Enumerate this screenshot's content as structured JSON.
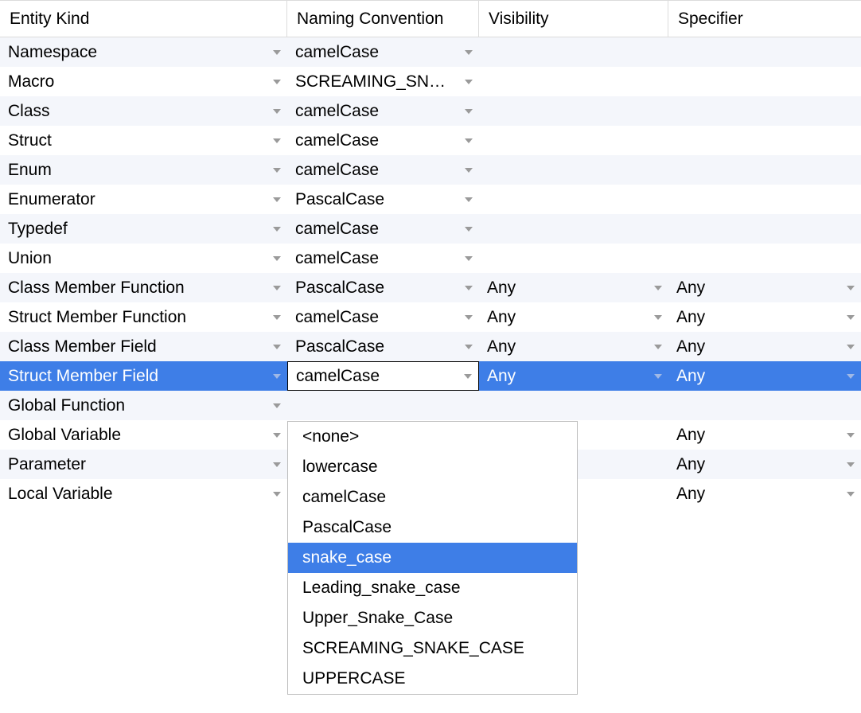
{
  "columns": [
    "Entity Kind",
    "Naming Convention",
    "Visibility",
    "Specifier"
  ],
  "rows": [
    {
      "kind": "Namespace",
      "naming": "camelCase",
      "visibility": null,
      "specifier": null
    },
    {
      "kind": "Macro",
      "naming": "SCREAMING_SN…",
      "visibility": null,
      "specifier": null
    },
    {
      "kind": "Class",
      "naming": "camelCase",
      "visibility": null,
      "specifier": null
    },
    {
      "kind": "Struct",
      "naming": "camelCase",
      "visibility": null,
      "specifier": null
    },
    {
      "kind": "Enum",
      "naming": "camelCase",
      "visibility": null,
      "specifier": null
    },
    {
      "kind": "Enumerator",
      "naming": "PascalCase",
      "visibility": null,
      "specifier": null
    },
    {
      "kind": "Typedef",
      "naming": "camelCase",
      "visibility": null,
      "specifier": null
    },
    {
      "kind": "Union",
      "naming": "camelCase",
      "visibility": null,
      "specifier": null
    },
    {
      "kind": "Class Member Function",
      "naming": "PascalCase",
      "visibility": "Any",
      "specifier": "Any"
    },
    {
      "kind": "Struct Member Function",
      "naming": "camelCase",
      "visibility": "Any",
      "specifier": "Any"
    },
    {
      "kind": "Class Member Field",
      "naming": "PascalCase",
      "visibility": "Any",
      "specifier": "Any"
    },
    {
      "kind": "Struct Member Field",
      "naming": "camelCase",
      "visibility": "Any",
      "specifier": "Any",
      "selected": true,
      "editing_naming": true
    },
    {
      "kind": "Global Function",
      "naming": "",
      "visibility": "",
      "specifier": ""
    },
    {
      "kind": "Global Variable",
      "naming": "",
      "visibility": "",
      "specifier": "Any"
    },
    {
      "kind": "Parameter",
      "naming": "",
      "visibility": "",
      "specifier": "Any"
    },
    {
      "kind": "Local Variable",
      "naming": "",
      "visibility": "",
      "specifier": "Any"
    }
  ],
  "dropdown": {
    "options": [
      "<none>",
      "lowercase",
      "camelCase",
      "PascalCase",
      "snake_case",
      "Leading_snake_case",
      "Upper_Snake_Case",
      "SCREAMING_SNAKE_CASE",
      "UPPERCASE"
    ],
    "highlighted": "snake_case"
  }
}
